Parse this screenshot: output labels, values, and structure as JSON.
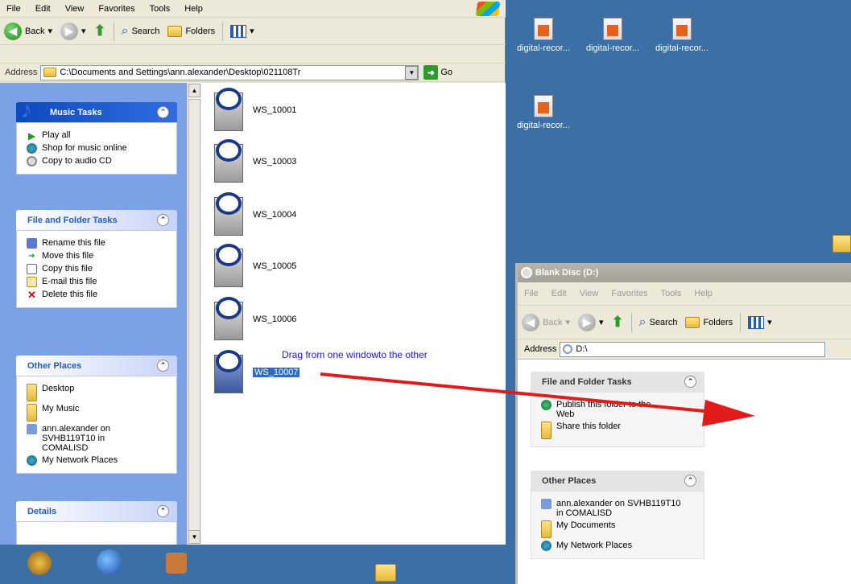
{
  "explorer": {
    "menu": [
      "File",
      "Edit",
      "View",
      "Favorites",
      "Tools",
      "Help"
    ],
    "toolbar": {
      "back": "Back",
      "search": "Search",
      "folders": "Folders"
    },
    "address": {
      "label": "Address",
      "value": "C:\\Documents and Settings\\ann.alexander\\Desktop\\021108Tr",
      "go": "Go"
    },
    "music_tasks": {
      "title": "Music Tasks",
      "items": [
        "Play all",
        "Shop for music online",
        "Copy to audio CD"
      ]
    },
    "file_tasks": {
      "title": "File and Folder Tasks",
      "items": [
        "Rename this file",
        "Move this file",
        "Copy this file",
        "E-mail this file",
        "Delete this file"
      ]
    },
    "other_places": {
      "title": "Other Places",
      "items": [
        "Desktop",
        "My Music",
        "ann.alexander on SVHB119T10 in COMALISD",
        "My Network Places"
      ]
    },
    "details": {
      "title": "Details"
    },
    "files": [
      "WS_10001",
      "WS_10003",
      "WS_10004",
      "WS_10005",
      "WS_10006",
      "WS_10007"
    ],
    "selected_file": "WS_10007"
  },
  "annotation": "Drag from one windowto the other",
  "desktop_icons": [
    "digital-recor...",
    "digital-recor...",
    "digital-recor...",
    "digital-recor..."
  ],
  "disc_window": {
    "title": "Blank Disc (D:)",
    "menu": [
      "File",
      "Edit",
      "View",
      "Favorites",
      "Tools",
      "Help"
    ],
    "toolbar": {
      "back": "Back",
      "search": "Search",
      "folders": "Folders"
    },
    "address": {
      "label": "Address",
      "value": "D:\\"
    },
    "file_tasks": {
      "title": "File and Folder Tasks",
      "items": [
        "Publish this folder to the Web",
        "Share this folder"
      ]
    },
    "other_places": {
      "title": "Other Places",
      "items": [
        "ann.alexander on SVHB119T10 in COMALISD",
        "My Documents",
        "My Network Places"
      ]
    }
  },
  "colors": {
    "desktop": "#3b6fa6",
    "task_pane": "#7ba2e7",
    "selection": "#316ac5",
    "arrow": "#e11a1a",
    "annotation": "#1a1adc"
  }
}
